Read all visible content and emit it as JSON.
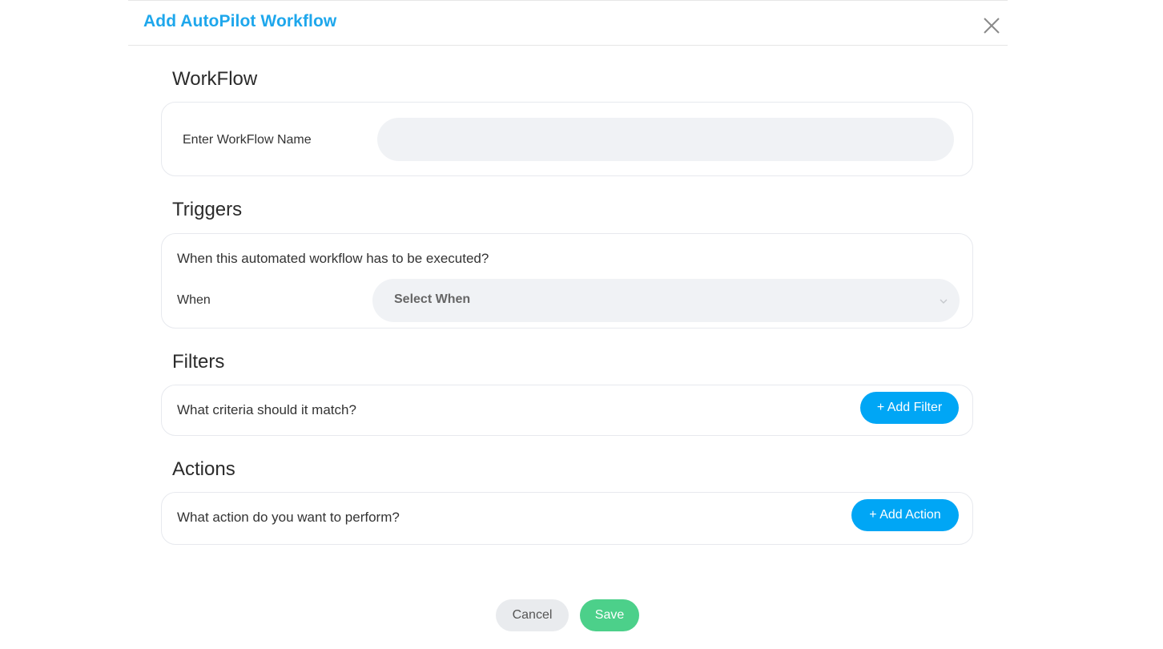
{
  "modal": {
    "title": "Add AutoPilot Workflow",
    "close_icon": "close-icon"
  },
  "workflow": {
    "section_title": "WorkFlow",
    "name_label": "Enter WorkFlow Name",
    "name_value": ""
  },
  "triggers": {
    "section_title": "Triggers",
    "question": "When this automated workflow has to be executed?",
    "when_label": "When",
    "when_selected": "Select When",
    "chevron_icon": "chevron-down-icon"
  },
  "filters": {
    "section_title": "Filters",
    "question": "What criteria should it match?",
    "add_button": "+ Add Filter"
  },
  "actions": {
    "section_title": "Actions",
    "question": "What action do you want to perform?",
    "add_button": "+ Add Action"
  },
  "footer": {
    "cancel_label": "Cancel",
    "save_label": "Save"
  },
  "colors": {
    "accent": "#1ea7ec",
    "button_blue": "#00a6f5",
    "save_green": "#4cd08a",
    "input_bg": "#f0f2f5"
  }
}
